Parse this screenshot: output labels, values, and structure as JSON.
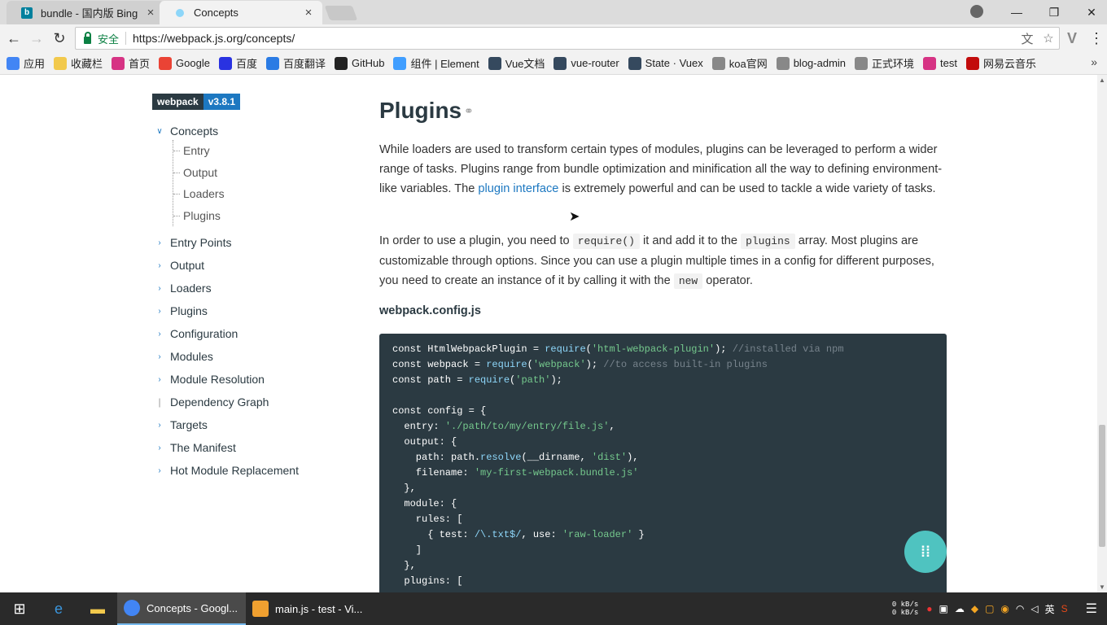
{
  "tabs": [
    {
      "title": "bundle - 国内版 Bing",
      "close": "×"
    },
    {
      "title": "Concepts",
      "close": "×"
    }
  ],
  "window": {
    "minimize": "—",
    "restore": "❐",
    "close": "✕"
  },
  "toolbar": {
    "back": "←",
    "forward": "→",
    "reload": "↻",
    "secure_label": "安全",
    "url": "https://webpack.js.org/concepts/",
    "translate": "文",
    "star": "☆",
    "menu": "⋮",
    "ext": "V"
  },
  "bookmarks": [
    {
      "label": "应用",
      "color": "#4285f4"
    },
    {
      "label": "收藏栏",
      "color": "#f2c94c"
    },
    {
      "label": "首页",
      "color": "#d63384"
    },
    {
      "label": "Google",
      "color": "#ea4335"
    },
    {
      "label": "百度",
      "color": "#2932e1"
    },
    {
      "label": "百度翻译",
      "color": "#2a7be4"
    },
    {
      "label": "GitHub",
      "color": "#222222"
    },
    {
      "label": "组件 | Element",
      "color": "#409eff"
    },
    {
      "label": "Vue文档",
      "color": "#35495e"
    },
    {
      "label": "vue-router",
      "color": "#35495e"
    },
    {
      "label": "State · Vuex",
      "color": "#35495e"
    },
    {
      "label": "koa官网",
      "color": "#888888"
    },
    {
      "label": "blog-admin",
      "color": "#888888"
    },
    {
      "label": "正式环境",
      "color": "#888888"
    },
    {
      "label": "test",
      "color": "#d63384"
    },
    {
      "label": "网易云音乐",
      "color": "#c20c0c"
    }
  ],
  "bookmarks_more": "»",
  "badge": {
    "name": "webpack",
    "version": "v3.8.1"
  },
  "sidebar": {
    "open_section": {
      "label": "Concepts",
      "chevron": "⌄"
    },
    "sub_items": [
      "Entry",
      "Output",
      "Loaders",
      "Plugins"
    ],
    "items": [
      {
        "label": "Entry Points",
        "marker": "›"
      },
      {
        "label": "Output",
        "marker": "›"
      },
      {
        "label": "Loaders",
        "marker": "›"
      },
      {
        "label": "Plugins",
        "marker": "›"
      },
      {
        "label": "Configuration",
        "marker": "›"
      },
      {
        "label": "Modules",
        "marker": "›"
      },
      {
        "label": "Module Resolution",
        "marker": "›"
      },
      {
        "label": "Dependency Graph",
        "marker": "|"
      },
      {
        "label": "Targets",
        "marker": "›"
      },
      {
        "label": "The Manifest",
        "marker": "›"
      },
      {
        "label": "Hot Module Replacement",
        "marker": "›"
      }
    ]
  },
  "content": {
    "heading": "Plugins",
    "anchor": "⚭",
    "p1_a": "While loaders are used to transform certain types of modules, plugins can be leveraged to perform a wider range of tasks. Plugins range from bundle optimization and minification all the way to defining environment-like variables. The ",
    "p1_link": "plugin interface",
    "p1_b": " is extremely powerful and can be used to tackle a wide variety of tasks.",
    "p2_a": "In order to use a plugin, you need to ",
    "p2_code1": "require()",
    "p2_b": " it and add it to the ",
    "p2_code2": "plugins",
    "p2_c": " array. Most plugins are customizable through options. Since you can use a plugin multiple times in a config for different purposes, you need to create an instance of it by calling it with the ",
    "p2_code3": "new",
    "p2_d": " operator.",
    "filename": "webpack.config.js",
    "code_lines": [
      [
        [
          "const HtmlWebpackPlugin = ",
          "#ffffff"
        ],
        [
          "require",
          "#8dd6f9"
        ],
        [
          "(",
          "#ffffff"
        ],
        [
          "'html-webpack-plugin'",
          "#75c98d"
        ],
        [
          "); ",
          "#ffffff"
        ],
        [
          "//installed via npm",
          "#77838c"
        ]
      ],
      [
        [
          "const webpack = ",
          "#ffffff"
        ],
        [
          "require",
          "#8dd6f9"
        ],
        [
          "(",
          "#ffffff"
        ],
        [
          "'webpack'",
          "#75c98d"
        ],
        [
          "); ",
          "#ffffff"
        ],
        [
          "//to access built-in plugins",
          "#77838c"
        ]
      ],
      [
        [
          "const path = ",
          "#ffffff"
        ],
        [
          "require",
          "#8dd6f9"
        ],
        [
          "(",
          "#ffffff"
        ],
        [
          "'path'",
          "#75c98d"
        ],
        [
          ");",
          "#ffffff"
        ]
      ],
      [
        [
          "",
          "#ffffff"
        ]
      ],
      [
        [
          "const config = {",
          "#ffffff"
        ]
      ],
      [
        [
          "  entry: ",
          "#ffffff"
        ],
        [
          "'./path/to/my/entry/file.js'",
          "#75c98d"
        ],
        [
          ",",
          "#ffffff"
        ]
      ],
      [
        [
          "  output: {",
          "#ffffff"
        ]
      ],
      [
        [
          "    path: path.",
          "#ffffff"
        ],
        [
          "resolve",
          "#8dd6f9"
        ],
        [
          "(__dirname, ",
          "#ffffff"
        ],
        [
          "'dist'",
          "#75c98d"
        ],
        [
          "),",
          "#ffffff"
        ]
      ],
      [
        [
          "    filename: ",
          "#ffffff"
        ],
        [
          "'my-first-webpack.bundle.js'",
          "#75c98d"
        ]
      ],
      [
        [
          "  },",
          "#ffffff"
        ]
      ],
      [
        [
          "  module: {",
          "#ffffff"
        ]
      ],
      [
        [
          "    rules: [",
          "#ffffff"
        ]
      ],
      [
        [
          "      { test: ",
          "#ffffff"
        ],
        [
          "/\\.txt$/",
          "#8dd6f9"
        ],
        [
          ", use: ",
          "#ffffff"
        ],
        [
          "'raw-loader'",
          "#75c98d"
        ],
        [
          " }",
          "#ffffff"
        ]
      ],
      [
        [
          "    ]",
          "#ffffff"
        ]
      ],
      [
        [
          "  },",
          "#ffffff"
        ]
      ],
      [
        [
          "  plugins: [",
          "#ffffff"
        ]
      ]
    ]
  },
  "fab_icon": "gitter-icon",
  "taskbar": {
    "tasks": [
      {
        "label": "Concepts - Googl...",
        "color": "#4285f4"
      },
      {
        "label": "main.js - test - Vi...",
        "color": "#f0a030"
      }
    ],
    "net_up": "0 kB/s",
    "net_down": "0 kB/s",
    "ime": "英",
    "notif": "☰"
  },
  "colors": {
    "accent": "#1d78c1",
    "dark": "#2b3a42",
    "fab": "#4fc3c0"
  }
}
